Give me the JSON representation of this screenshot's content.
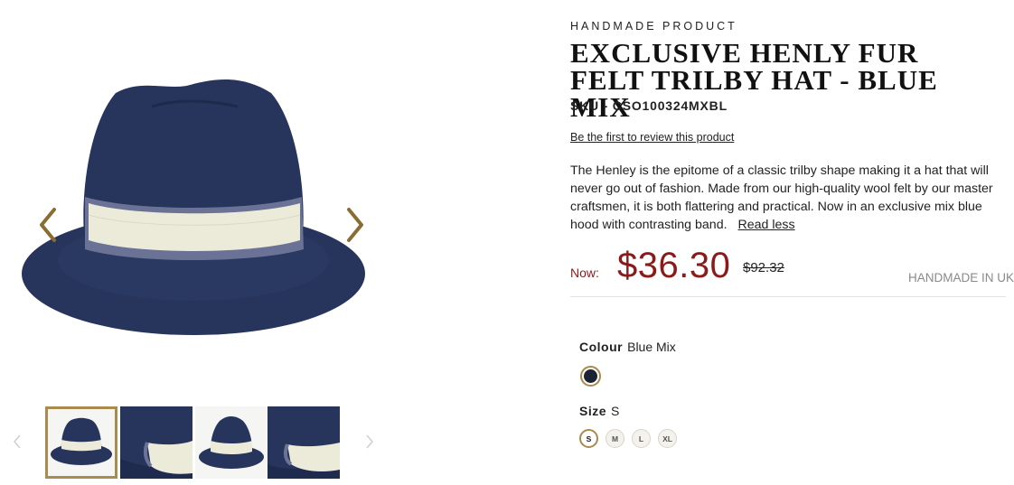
{
  "product": {
    "eyebrow": "HANDMADE PRODUCT",
    "title": "EXCLUSIVE HENLY FUR FELT TRILBY HAT - BLUE MIX",
    "sku": "SKU - CSO100324MXBL",
    "review_link": "Be the first to review this product",
    "description": "The Henley is the epitome of a classic trilby shape making it a hat that will never go out of fashion. Made from our high-quality wool felt by our master craftsmen, it is both flattering and practical. Now in an exclusive mix blue hood with contrasting band.",
    "read_less": "Read less"
  },
  "pricing": {
    "now_label": "Now:",
    "current": "$36.30",
    "original": "$92.32",
    "origin": "HANDMADE IN UK"
  },
  "options": {
    "colour_label": "Colour",
    "colour_value": "Blue Mix",
    "size_label": "Size",
    "size_value": "S",
    "sizes": [
      "S",
      "M",
      "L",
      "XL"
    ]
  },
  "colors": {
    "accent_gold": "#a98a4f",
    "price_red": "#8b1a1a",
    "hat_navy": "#27355c"
  },
  "gallery": {
    "thumbnail_count": 4,
    "active_thumbnail": 1
  }
}
